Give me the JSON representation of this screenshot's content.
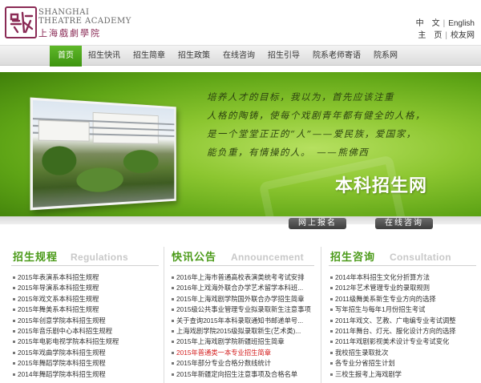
{
  "header": {
    "logo_en_line1": "SHANGHAI",
    "logo_en_line2": "THEATRE ACADEMY",
    "logo_cn": "上海戲劇學院",
    "lang_cn": "中　文",
    "lang_en": "English",
    "home": "主　页",
    "alumni": "校友网"
  },
  "nav": {
    "items": [
      "首页",
      "招生快讯",
      "招生简章",
      "招生政策",
      "在线咨询",
      "招生引导",
      "院系老师寄语",
      "院系网"
    ]
  },
  "banner": {
    "quote_line1": "培养人才的目标，我以为，首先应该注重",
    "quote_line2": "人格的陶铸，使每个戏剧青年都有健全的人格，",
    "quote_line3": "是一个堂堂正正的“人”——爱民族，爱国家，",
    "quote_line4": "能负重，有情操的人。　——熊佛西",
    "headline": "本科招生网",
    "btn_register": "网上报名",
    "btn_consult": "在线咨询"
  },
  "columns": {
    "regulations": {
      "title_cn": "招生规程",
      "title_en": "Regulations",
      "items": [
        "2015年表演系本科招生规程",
        "2015年导演系本科招生规程",
        "2015年戏文系本科招生规程",
        "2015年舞美系本科招生规程",
        "2015年创意学院本科招生规程",
        "2015年音乐剧中心本科招生规程",
        "2015年电影电视学院本科招生规程",
        "2015年戏曲学院本科招生规程",
        "2015年舞蹈学院本科招生规程",
        "2014年舞蹈学院本科招生规程"
      ]
    },
    "announcement": {
      "title_cn": "快讯公告",
      "title_en": "Announcement",
      "items": [
        "2016年上海市普通高校表演类统考考试安排",
        "2016年上戏海外联合办学艺术留学本科班...",
        "2015年上海戏剧学院国外联合办学招生简章",
        "2015级公共事业管理专业拟录取新生注意事项",
        "关于查询2015年本科录取通知书邮递单号...",
        "上海戏剧学院2015级拟录取新生(艺术类)...",
        "2015年上海戏剧学院新疆班招生简章",
        "2015年普通类一本专业招生简章",
        "2015年部分专业合格分数线统计",
        "2015年新疆定向招生注意事项及合格名单"
      ],
      "highlight_index": 7
    },
    "consultation": {
      "title_cn": "招生咨询",
      "title_en": "Consultation",
      "items": [
        "2014年本科招生文化分折算方法",
        "2012年艺术管理专业的录取规则",
        "2011级舞美系新生专业方向的选择",
        "写年招生与每年1月份招生考试",
        "2011年戏文、艺教、广电编专业考试调整",
        "2011年舞台、灯光、服化设计方向的选择",
        "2011年戏剧影视美术设计专业考试变化",
        "我校招生录取批次",
        "各专业分省招生计划",
        "三校生报考上海戏剧学"
      ]
    }
  }
}
